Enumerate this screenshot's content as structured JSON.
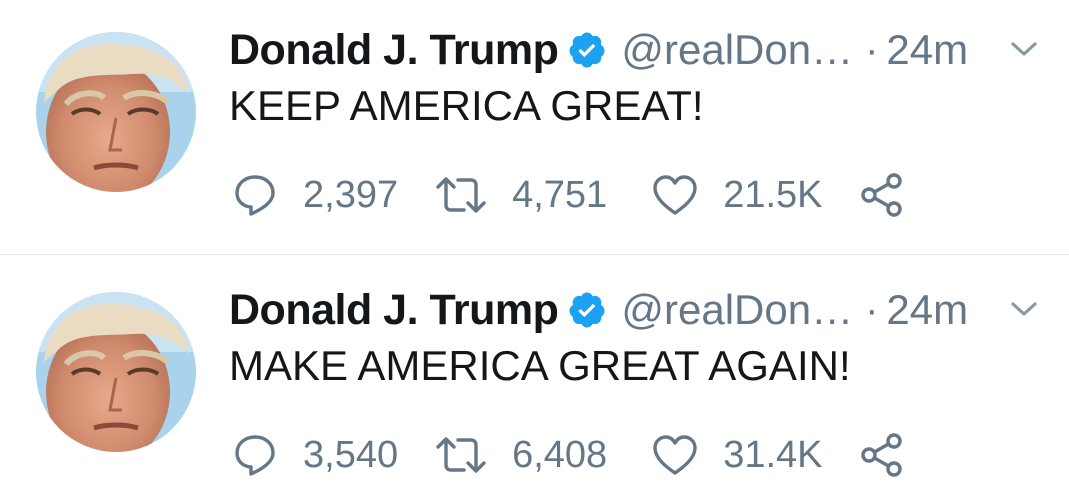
{
  "tweets": [
    {
      "author_name": "Donald J. Trump",
      "handle": "@realDon…",
      "separator": "·",
      "time": "24m",
      "text": "KEEP AMERICA GREAT!",
      "replies": "2,397",
      "retweets": "4,751",
      "likes": "21.5K"
    },
    {
      "author_name": "Donald J. Trump",
      "handle": "@realDon…",
      "separator": "·",
      "time": "24m",
      "text": "MAKE AMERICA GREAT AGAIN!",
      "replies": "3,540",
      "retweets": "6,408",
      "likes": "31.4K"
    }
  ],
  "icons": {
    "verified": "verified-badge-icon",
    "menu": "chevron-down-icon",
    "reply": "reply-bubble-icon",
    "retweet": "retweet-icon",
    "like": "heart-icon",
    "share": "share-icon"
  },
  "colors": {
    "verified_blue": "#1da1f2",
    "secondary_text": "#657786",
    "primary_text": "#14171a",
    "divider": "#e6ecf0"
  }
}
